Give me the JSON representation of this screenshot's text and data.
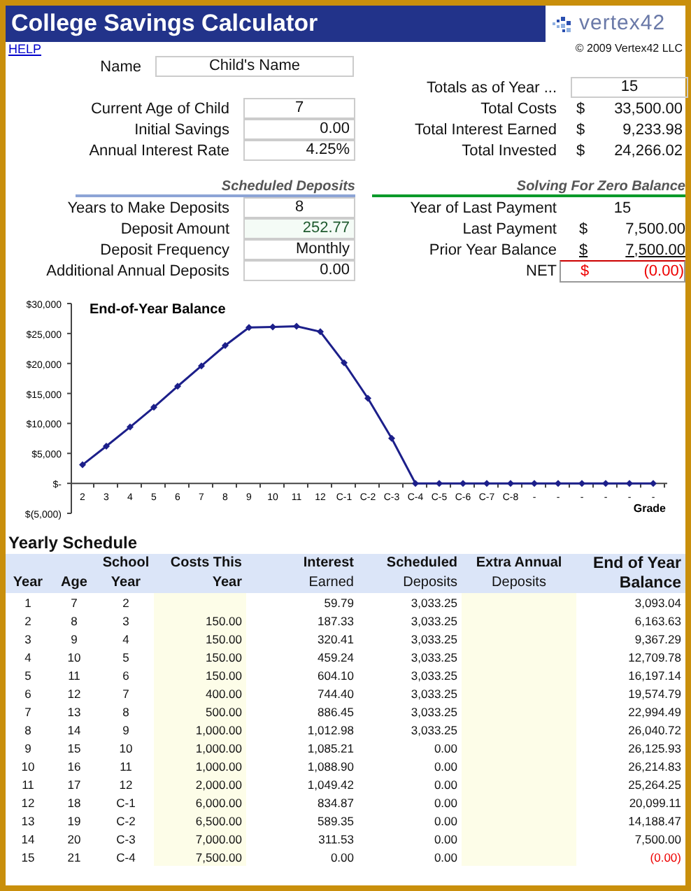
{
  "header": {
    "title": "College Savings Calculator",
    "logo": "vertex42"
  },
  "help_link": "HELP",
  "copyright": "© 2009 Vertex42 LLC",
  "inputs": [
    {
      "label": "Name",
      "value": "Child's Name"
    },
    {
      "label": "Current Age of Child",
      "value": "7"
    },
    {
      "label": "Initial Savings",
      "value": "0.00"
    },
    {
      "label": "Annual Interest Rate",
      "value": "4.25%"
    }
  ],
  "totals": {
    "label": "Totals as of Year ...",
    "value": "15",
    "rows": [
      {
        "label": "Total Costs",
        "currency": "$",
        "value": "33,500.00"
      },
      {
        "label": "Total Interest Earned",
        "currency": "$",
        "value": "9,233.98"
      },
      {
        "label": "Total Invested",
        "currency": "$",
        "value": "24,266.02"
      }
    ]
  },
  "scheduled_deposits": {
    "title": "Scheduled Deposits",
    "rows": [
      {
        "label": "Years to Make Deposits",
        "value": "8",
        "kind": "input"
      },
      {
        "label": "Deposit Amount",
        "value": "252.77",
        "kind": "result"
      },
      {
        "label": "Deposit Frequency",
        "value": "Monthly",
        "kind": "input"
      },
      {
        "label": "Additional Annual Deposits",
        "value": "0.00",
        "kind": "input"
      }
    ]
  },
  "zero_balance": {
    "title": "Solving For Zero Balance",
    "rows": [
      {
        "label": "Year of Last Payment",
        "value": "15",
        "kind": "plain"
      },
      {
        "label": "Last Payment",
        "currency": "$",
        "value": "7,500.00",
        "kind": "plain"
      },
      {
        "label": "Prior Year Balance",
        "currency": "$",
        "value": "7,500.00",
        "kind": "subtotal"
      },
      {
        "label": "NET",
        "currency": "$",
        "value": "(0.00)",
        "kind": "net"
      }
    ]
  },
  "chart_data": {
    "type": "line",
    "title": "End-of-Year Balance",
    "xlabel": "Grade",
    "categories": [
      "2",
      "3",
      "4",
      "5",
      "6",
      "7",
      "8",
      "9",
      "10",
      "11",
      "12",
      "C-1",
      "C-2",
      "C-3",
      "C-4",
      "C-5",
      "C-6",
      "C-7",
      "C-8",
      "-",
      "-",
      "-",
      "-",
      "-",
      "-"
    ],
    "series": [
      {
        "color": "#1c1f8a",
        "marker": "diamond",
        "values": [
          3100,
          6200,
          9400,
          12700,
          16200,
          19600,
          23000,
          26000,
          26100,
          26200,
          25300,
          20100,
          14200,
          7500,
          0,
          0,
          0,
          0,
          0,
          0,
          0,
          0,
          0,
          0,
          0
        ]
      }
    ],
    "ylim": [
      -5000,
      30000
    ],
    "yticks": [
      {
        "value": -5000,
        "label": "$(5,000)"
      },
      {
        "value": 0,
        "label": "$-"
      },
      {
        "value": 5000,
        "label": "$5,000"
      },
      {
        "value": 10000,
        "label": "$10,000"
      },
      {
        "value": 15000,
        "label": "$15,000"
      },
      {
        "value": 20000,
        "label": "$20,000"
      },
      {
        "value": 25000,
        "label": "$25,000"
      },
      {
        "value": 30000,
        "label": "$30,000"
      }
    ]
  },
  "schedule": {
    "title": "Yearly Schedule",
    "header_rows": [
      [
        null,
        null,
        "School",
        "Costs This",
        "Interest",
        "Scheduled",
        "Extra Annual",
        "End of Year"
      ],
      [
        "Year",
        "Age",
        "Year",
        "Year",
        "Earned",
        "Deposits",
        "Deposits",
        "Balance"
      ]
    ],
    "rows": [
      {
        "cells": [
          "1",
          "7",
          "2",
          null,
          "59.79",
          "3,033.25",
          null,
          "3,093.04"
        ],
        "negative": false
      },
      {
        "cells": [
          "2",
          "8",
          "3",
          "150.00",
          "187.33",
          "3,033.25",
          null,
          "6,163.63"
        ],
        "negative": false
      },
      {
        "cells": [
          "3",
          "9",
          "4",
          "150.00",
          "320.41",
          "3,033.25",
          null,
          "9,367.29"
        ],
        "negative": false
      },
      {
        "cells": [
          "4",
          "10",
          "5",
          "150.00",
          "459.24",
          "3,033.25",
          null,
          "12,709.78"
        ],
        "negative": false
      },
      {
        "cells": [
          "5",
          "11",
          "6",
          "150.00",
          "604.10",
          "3,033.25",
          null,
          "16,197.14"
        ],
        "negative": false
      },
      {
        "cells": [
          "6",
          "12",
          "7",
          "400.00",
          "744.40",
          "3,033.25",
          null,
          "19,574.79"
        ],
        "negative": false
      },
      {
        "cells": [
          "7",
          "13",
          "8",
          "500.00",
          "886.45",
          "3,033.25",
          null,
          "22,994.49"
        ],
        "negative": false
      },
      {
        "cells": [
          "8",
          "14",
          "9",
          "1,000.00",
          "1,012.98",
          "3,033.25",
          null,
          "26,040.72"
        ],
        "negative": false
      },
      {
        "cells": [
          "9",
          "15",
          "10",
          "1,000.00",
          "1,085.21",
          "0.00",
          null,
          "26,125.93"
        ],
        "negative": false
      },
      {
        "cells": [
          "10",
          "16",
          "11",
          "1,000.00",
          "1,088.90",
          "0.00",
          null,
          "26,214.83"
        ],
        "negative": false
      },
      {
        "cells": [
          "11",
          "17",
          "12",
          "2,000.00",
          "1,049.42",
          "0.00",
          null,
          "25,264.25"
        ],
        "negative": false
      },
      {
        "cells": [
          "12",
          "18",
          "C-1",
          "6,000.00",
          "834.87",
          "0.00",
          null,
          "20,099.11"
        ],
        "negative": false
      },
      {
        "cells": [
          "13",
          "19",
          "C-2",
          "6,500.00",
          "589.35",
          "0.00",
          null,
          "14,188.47"
        ],
        "negative": false
      },
      {
        "cells": [
          "14",
          "20",
          "C-3",
          "7,000.00",
          "311.53",
          "0.00",
          null,
          "7,500.00"
        ],
        "negative": false
      },
      {
        "cells": [
          "15",
          "21",
          "C-4",
          "7,500.00",
          "0.00",
          "0.00",
          null,
          "(0.00)"
        ],
        "negative": true
      }
    ]
  }
}
